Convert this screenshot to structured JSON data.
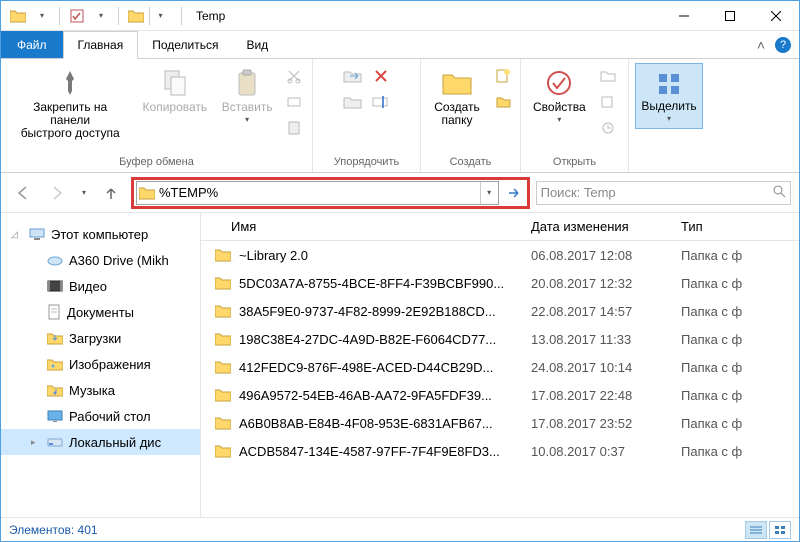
{
  "window": {
    "title": "Temp"
  },
  "tabs": {
    "file": "Файл",
    "home": "Главная",
    "share": "Поделиться",
    "view": "Вид"
  },
  "ribbon": {
    "pin": "Закрепить на панели\nбыстрого доступа",
    "copy": "Копировать",
    "paste": "Вставить",
    "clipboard_group": "Буфер обмена",
    "new_folder": "Создать\nпапку",
    "organize_group": "Упорядочить",
    "new_group": "Создать",
    "properties": "Свойства",
    "open_group": "Открыть",
    "select": "Выделить"
  },
  "nav": {
    "address_value": "%TEMP%",
    "search_placeholder": "Поиск: Temp"
  },
  "sidebar": {
    "items": [
      {
        "label": "Этот компьютер",
        "icon": "pc"
      },
      {
        "label": "A360 Drive (Mikh",
        "icon": "a360"
      },
      {
        "label": "Видео",
        "icon": "video"
      },
      {
        "label": "Документы",
        "icon": "docs"
      },
      {
        "label": "Загрузки",
        "icon": "downloads"
      },
      {
        "label": "Изображения",
        "icon": "pictures"
      },
      {
        "label": "Музыка",
        "icon": "music"
      },
      {
        "label": "Рабочий стол",
        "icon": "desktop"
      },
      {
        "label": "Локальный дис",
        "icon": "disk"
      }
    ]
  },
  "columns": {
    "name": "Имя",
    "date": "Дата изменения",
    "type": "Тип"
  },
  "rows": [
    {
      "name": "~Library 2.0",
      "date": "06.08.2017 12:08",
      "type": "Папка с ф"
    },
    {
      "name": "5DC03A7A-8755-4BCE-8FF4-F39BCBF990...",
      "date": "20.08.2017 12:32",
      "type": "Папка с ф"
    },
    {
      "name": "38A5F9E0-9737-4F82-8999-2E92B188CD...",
      "date": "22.08.2017 14:57",
      "type": "Папка с ф"
    },
    {
      "name": "198C38E4-27DC-4A9D-B82E-F6064CD77...",
      "date": "13.08.2017 11:33",
      "type": "Папка с ф"
    },
    {
      "name": "412FEDC9-876F-498E-ACED-D44CB29D...",
      "date": "24.08.2017 10:14",
      "type": "Папка с ф"
    },
    {
      "name": "496A9572-54EB-46AB-AA72-9FA5FDF39...",
      "date": "17.08.2017 22:48",
      "type": "Папка с ф"
    },
    {
      "name": "A6B0B8AB-E84B-4F08-953E-6831AFB67...",
      "date": "17.08.2017 23:52",
      "type": "Папка с ф"
    },
    {
      "name": "ACDB5847-134E-4587-97FF-7F4F9E8FD3...",
      "date": "10.08.2017 0:37",
      "type": "Папка с ф"
    }
  ],
  "status": {
    "elements": "Элементов: 401"
  }
}
